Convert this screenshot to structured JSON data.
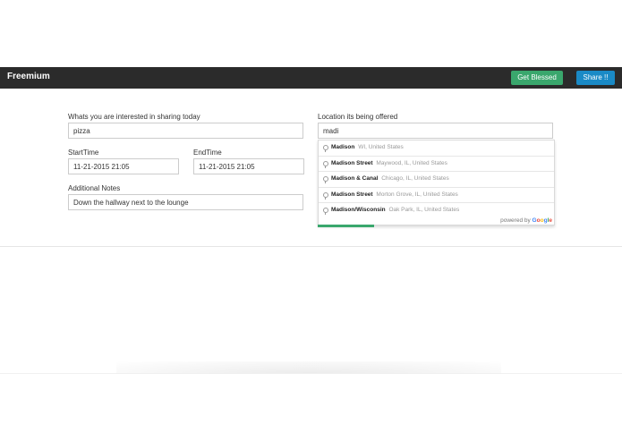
{
  "navbar": {
    "brand": "Freemium",
    "get_blessed_label": "Get Blessed",
    "share_label": "Share !!"
  },
  "form": {
    "interest_label": "Whats you are interested in sharing today",
    "interest_value": "pizza",
    "start_label": "StartTime",
    "start_value": "11-21-2015 21:05",
    "end_label": "EndTime",
    "end_value": "11-21-2015 21:05",
    "notes_label": "Additional Notes",
    "notes_value": "Down the hallway next to the lounge",
    "location_label": "Location its being offered",
    "location_value": "madi"
  },
  "suggestions": [
    {
      "main": "Madison",
      "secondary": "WI, United States"
    },
    {
      "main": "Madison Street",
      "secondary": "Maywood, IL, United States"
    },
    {
      "main": "Madison & Canal",
      "secondary": "Chicago, IL, United States"
    },
    {
      "main": "Madison Street",
      "secondary": "Morton Grove, IL, United States"
    },
    {
      "main": "Madison/Wisconsin",
      "secondary": "Oak Park, IL, United States"
    }
  ],
  "powered_by": {
    "prefix": "powered by",
    "letters": [
      "G",
      "o",
      "o",
      "g",
      "l",
      "e"
    ]
  },
  "colors": {
    "navbar": "#2b2b2b",
    "get_blessed": "#3aa76d",
    "share": "#1a8ac6",
    "progress": "#3aa76d"
  }
}
